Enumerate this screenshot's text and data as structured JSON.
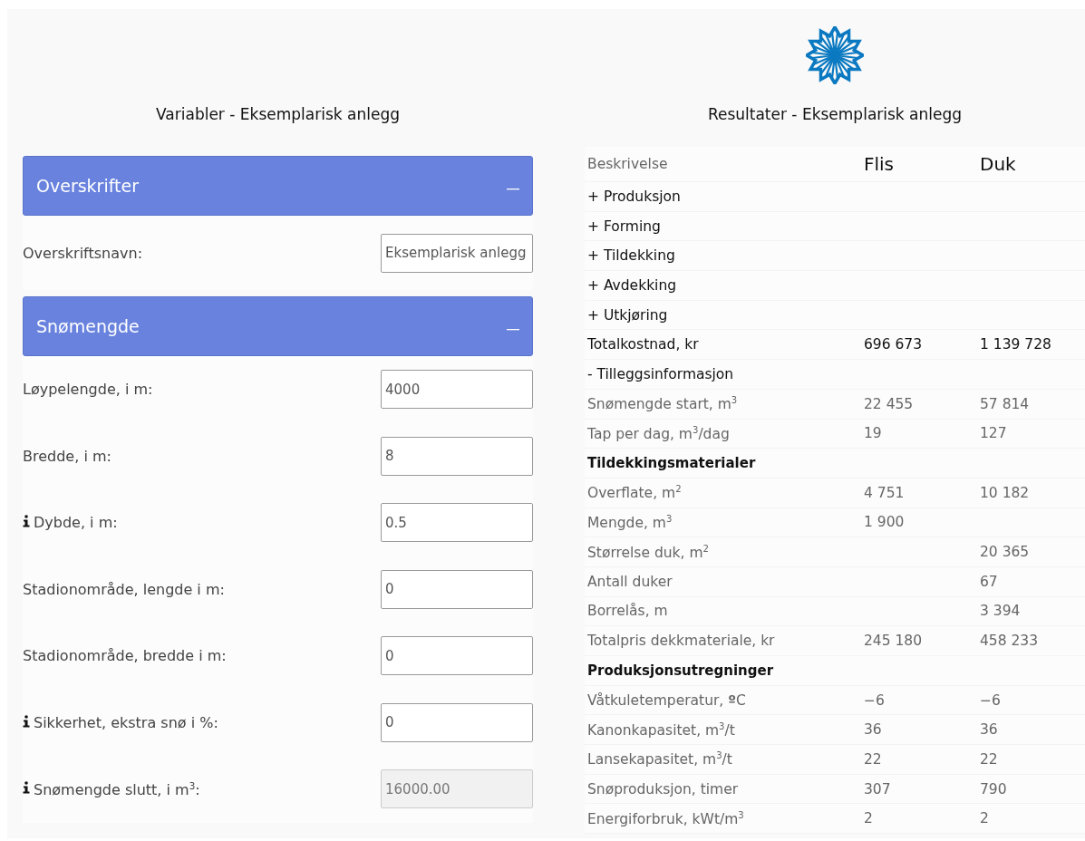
{
  "variables": {
    "title": "Variabler - Eksemplarisk anlegg",
    "panels": [
      {
        "title": "Overskrifter",
        "expanded": true,
        "fields": [
          {
            "label": "Overskriftsnavn:",
            "value": "Eksemplarisk anlegg",
            "info": false,
            "disabled": false
          }
        ]
      },
      {
        "title": "Snømengde",
        "expanded": true,
        "fields": [
          {
            "label": "Løypelengde, i m:",
            "value": "4000",
            "info": false,
            "disabled": false
          },
          {
            "label": "Bredde, i m:",
            "value": "8",
            "info": false,
            "disabled": false
          },
          {
            "label": "Dybde, i m:",
            "value": "0.5",
            "info": true,
            "disabled": false
          },
          {
            "label": "Stadionområde, lengde i m:",
            "value": "0",
            "info": false,
            "disabled": false
          },
          {
            "label": "Stadionområde, bredde i m:",
            "value": "0",
            "info": false,
            "disabled": false
          },
          {
            "label": "Sikkerhet, ekstra snø i %:",
            "value": "0",
            "info": true,
            "disabled": false
          },
          {
            "label": "Snømengde slutt, i m$^{3}$:",
            "value": "16000.00",
            "info": true,
            "disabled": true
          }
        ]
      }
    ]
  },
  "results": {
    "title": "Resultater - Eksemplarisk anlegg",
    "columns": [
      "Beskrivelse",
      "Flis",
      "Duk"
    ],
    "rows": [
      {
        "kind": "toggle",
        "label": "+ Produksjon"
      },
      {
        "kind": "toggle",
        "label": "+ Forming"
      },
      {
        "kind": "toggle",
        "label": "+ Tildekking"
      },
      {
        "kind": "toggle",
        "label": "+ Avdekking"
      },
      {
        "kind": "toggle",
        "label": "+ Utkjøring"
      },
      {
        "kind": "total",
        "label": "Totalkostnad, kr",
        "flis": "696 673",
        "duk": "1 139 728"
      },
      {
        "kind": "toggle",
        "label": "- Tilleggsinformasjon"
      },
      {
        "kind": "item",
        "label": "Snømengde start, m$^{3}$",
        "flis": "22 455",
        "duk": "57 814"
      },
      {
        "kind": "item",
        "label": "Tap per dag, m$^{3}$/dag",
        "flis": "19",
        "duk": "127"
      },
      {
        "kind": "section",
        "label": "Tildekkingsmaterialer"
      },
      {
        "kind": "item",
        "label": "Overflate, m$^{2}$",
        "flis": "4 751",
        "duk": "10 182"
      },
      {
        "kind": "item",
        "label": "Mengde, m$^{3}$",
        "flis": "1 900"
      },
      {
        "kind": "item",
        "label": "Størrelse duk, m$^{2}$",
        "duk": "20 365"
      },
      {
        "kind": "item",
        "label": "Antall duker",
        "duk": "67"
      },
      {
        "kind": "item",
        "label": "Borrelås, m",
        "duk": "3 394"
      },
      {
        "kind": "item",
        "label": "Totalpris dekkmateriale, kr",
        "flis": "245 180",
        "duk": "458 233"
      },
      {
        "kind": "section",
        "label": "Produksjonsutregninger"
      },
      {
        "kind": "item",
        "label": "Våtkuletemperatur, **º**C",
        "flis": "−6",
        "duk": "−6"
      },
      {
        "kind": "item",
        "label": "Kanonkapasitet, m$^{3}$/t",
        "flis": "36",
        "duk": "36"
      },
      {
        "kind": "item",
        "label": "Lansekapasitet, m$^{3}$/t",
        "flis": "22",
        "duk": "22"
      },
      {
        "kind": "item",
        "label": "Snøproduksjon, timer",
        "flis": "307",
        "duk": "790"
      },
      {
        "kind": "item",
        "label": "Energiforbruk, kWt/m$^{3}$",
        "flis": "2",
        "duk": "2"
      }
    ]
  }
}
